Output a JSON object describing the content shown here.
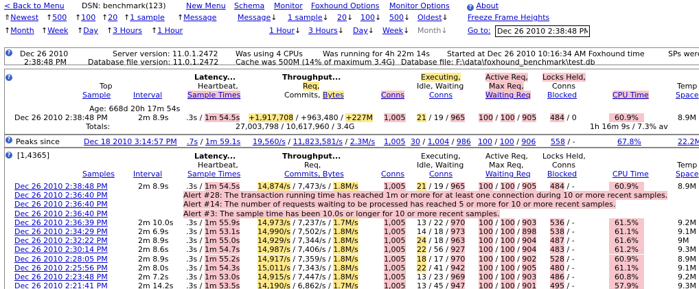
{
  "nav": {
    "back": "< Back to Menu",
    "dsn": "DSN: benchmark(123)",
    "new_menu": "New Menu",
    "schema": "Schema",
    "monitor": "Monitor",
    "foxhound_options": "Foxhound Options",
    "monitor_options": "Monitor Options",
    "about": "About",
    "newest": "Newest",
    "up500": "500",
    "up100": "100",
    "up20": "20",
    "up1sample": "1 sample",
    "message_up": "Message",
    "message_down": "Message",
    "down1sample": "1 sample",
    "down20": "20",
    "down100": "100",
    "down500": "500",
    "oldest": "Oldest",
    "freeze": "Freeze Frame Heights",
    "month_up": "Month",
    "week_up": "Week",
    "day_up": "Day",
    "hours3_up": "3 Hours",
    "hour1_up": "1 Hour",
    "hour1_down": "1 Hour",
    "hours3_down": "3 Hours",
    "day_down": "Day",
    "week_down": "Week",
    "month_down": "Month",
    "goto_label": "Go to:",
    "goto_value": "Dec 26 2010 2:38:48 PM"
  },
  "server": {
    "date": "Dec 26 2010",
    "time": "2:38:48 PM",
    "server_version": "Server version: 11.0.1.2472",
    "db_version": "Database file version: 11.0.1.2472",
    "cpus": "Was using 4 CPUs",
    "cache": "Cache was 500M (14% of maximum 3.4G)",
    "running": "Was running for 4h 22m 14s",
    "db_file": "Database file: F:\\data\\foxhound_benchmark\\test.db",
    "started": "Started at Dec 26 2010 10:16:34 AM Foxhound time",
    "sps": "SPs were"
  },
  "top": {
    "h_top": "Top",
    "h_sample": "Sample",
    "h_interval": "Interval",
    "h_latency": "Latency...",
    "h_heartbeat": "Heartbeat,",
    "h_sample_times": "Sample Times",
    "h_throughput": "Throughput...",
    "h_req": "Req,",
    "h_commits": "Commits,",
    "h_bytes": "Bytes",
    "h_conns": "Conns",
    "h_executing": "Executing,",
    "h_idle": "Idle, Waiting",
    "h_conns2": "Conns",
    "h_active": "Active Req,",
    "h_maxreq": "Max Req,",
    "h_waitingreq": "Waiting Req",
    "h_locks": "Locks Held,",
    "h_conns3": "Conns",
    "h_blocked": "Blocked",
    "h_cpu": "CPU Time",
    "h_temp": "Temp",
    "h_space": "Space",
    "age": "Age: 668d 20h 17m 54s",
    "r_sample": "Dec 26 2010 2:38:48 PM",
    "r_interval": "2m 8.9s",
    "r_hb": ".3s",
    "r_st": "1m 54.5s",
    "r_req": "+1,917,708",
    "r_commits": "+963,480",
    "r_bytes": "+227M",
    "r_conns": "1,005",
    "r_exec": "21",
    "r_idle": "19",
    "r_wait": "965",
    "r_active": "100",
    "r_max": "100",
    "r_waitreq": "905",
    "r_locks": "484",
    "r_blocked": "0",
    "r_cpu": "60.9%",
    "r_temp": "8.9M",
    "totals_label": "Totals:",
    "totals_tp": "27,003,798 / 10,617,960 / 3.4G",
    "totals_cpu": "1h 16m 9s / 7.3% av"
  },
  "peaks": {
    "label": "Peaks since",
    "since": "Dec 18 2010 3:14:57 PM",
    "hb": ".7s",
    "st": "1m 59.1s",
    "req": "19,560/s",
    "commits": "11,823,581/s",
    "bytes": "2.3M/s",
    "conns": "1,005",
    "exec": "30",
    "idle": "1,004",
    "wait": "986",
    "active": "100",
    "max": "100",
    "waitreq": "906",
    "locks": "558",
    "blocked": "-",
    "cpu": "67.8%",
    "temp": "22.2M"
  },
  "list": {
    "range": "[1,4365]",
    "h_samples": "Samples",
    "h_interval": "Interval",
    "h_latency": "Latency...",
    "h_heartbeat": "Heartbeat,",
    "h_sample_times": "Sample Times",
    "h_throughput": "Throughput...",
    "h_req": "Req,",
    "h_commits_bytes": "Commits, Bytes",
    "h_conns": "Conns",
    "h_executing": "Executing,",
    "h_idle": "Idle, Waiting",
    "h_conns2": "Conns",
    "h_active": "Active Req,",
    "h_maxreq": "Max Req,",
    "h_waitingreq": "Waiting Req",
    "h_locks": "Locks Held,",
    "h_conns3": "Conns",
    "h_blocked": "Blocked",
    "h_cpu": "CPU Time",
    "h_temp": "Temp",
    "h_space": "Space",
    "rows": [
      {
        "s": "Dec 26 2010 2:38:48 PM",
        "i": "2m 8.9s",
        "hb": ".3s",
        "st": "1m 54.5s",
        "req": "14,874/s",
        "com": "7,473/s",
        "by": "1.8M/s",
        "cn": "1,005",
        "ex": "21",
        "id": "19",
        "wt": "965",
        "ac": "100",
        "mx": "100",
        "wr": "905",
        "lk": "484",
        "bl": "-",
        "cpu": "60.9%",
        "tmp": "8.9M",
        "kind": "data"
      },
      {
        "s": "Dec 26 2010 2:36:40 PM",
        "alert": "Alert #28: The transaction running time has reached 1m or more for at least one connection during 10 or more recent samples.",
        "kind": "alert"
      },
      {
        "s": "Dec 26 2010 2:36:40 PM",
        "alert": "Alert #14: The number of requests waiting to be processed has reached 5 or more for 10 or more recent samples.",
        "kind": "alert"
      },
      {
        "s": "Dec 26 2010 2:36:40 PM",
        "alert": "Alert #3: The sample time has been 10.0s or longer for 10 or more recent samples.",
        "kind": "alert"
      },
      {
        "s": "Dec 26 2010 2:36:39 PM",
        "i": "2m 10.0s",
        "hb": ".3s",
        "st": "1m 55.9s",
        "req": "14,973/s",
        "com": "7,237/s",
        "by": "1.7M/s",
        "cn": "1,005",
        "ex": "13",
        "id": "22",
        "wt": "970",
        "ac": "100",
        "mx": "100",
        "wr": "903",
        "lk": "536",
        "bl": "-",
        "cpu": "61.5%",
        "tmp": "9.2M",
        "kind": "data"
      },
      {
        "s": "Dec 26 2010 2:34:29 PM",
        "i": "2m 6.9s",
        "hb": ".3s",
        "st": "1m 53.1s",
        "req": "14,990/s",
        "com": "7,502/s",
        "by": "1.8M/s",
        "cn": "1,005",
        "ex": "14",
        "id": "18",
        "wt": "973",
        "ac": "100",
        "mx": "100",
        "wr": "898",
        "lk": "538",
        "bl": "-",
        "cpu": "61.1%",
        "tmp": "9.1M",
        "kind": "data"
      },
      {
        "s": "Dec 26 2010 2:32:22 PM",
        "i": "2m 8.9s",
        "hb": ".3s",
        "st": "1m 55.0s",
        "req": "14,929/s",
        "com": "7,344/s",
        "by": "1.8M/s",
        "cn": "1,005",
        "ex": "24",
        "id": "18",
        "wt": "963",
        "ac": "100",
        "mx": "100",
        "wr": "904",
        "lk": "487",
        "bl": "-",
        "cpu": "61.6%",
        "tmp": "9M",
        "kind": "data"
      },
      {
        "s": "Dec 26 2010 2:30:14 PM",
        "i": "2m 8.6s",
        "hb": ".3s",
        "st": "1m 54.7s",
        "req": "14,987/s",
        "com": "7,406/s",
        "by": "1.8M/s",
        "cn": "1,005",
        "ex": "22",
        "id": "56",
        "wt": "927",
        "ac": "100",
        "mx": "100",
        "wr": "904",
        "lk": "483",
        "bl": "-",
        "cpu": "61.2%",
        "tmp": "9.3M",
        "kind": "data"
      },
      {
        "s": "Dec 26 2010 2:28:05 PM",
        "i": "2m 8.9s",
        "hb": ".3s",
        "st": "1m 55.2s",
        "req": "14,917/s",
        "com": "7,359/s",
        "by": "1.8M/s",
        "cn": "1,005",
        "ex": "18",
        "id": "17",
        "wt": "970",
        "ac": "100",
        "mx": "100",
        "wr": "902",
        "lk": "528",
        "bl": "-",
        "cpu": "60.9%",
        "tmp": "8.9M",
        "kind": "data"
      },
      {
        "s": "Dec 26 2010 2:25:56 PM",
        "i": "2m 8.0s",
        "hb": ".3s",
        "st": "1m 54.3s",
        "req": "15,011/s",
        "com": "7,343/s",
        "by": "1.8M/s",
        "cn": "1,005",
        "ex": "22",
        "id": "41",
        "wt": "942",
        "ac": "100",
        "mx": "100",
        "wr": "905",
        "lk": "480",
        "bl": "-",
        "cpu": "61.1%",
        "tmp": "9.1M",
        "kind": "data"
      },
      {
        "s": "Dec 26 2010 2:23:48 PM",
        "i": "2m 7.2s",
        "hb": ".3s",
        "st": "1m 53.0s",
        "req": "14,915/s",
        "com": "7,447/s",
        "by": "1.8M/s",
        "cn": "1,005",
        "ex": "13",
        "id": "23",
        "wt": "969",
        "ac": "100",
        "mx": "100",
        "wr": "903",
        "lk": "486",
        "bl": "-",
        "cpu": "60.8%",
        "tmp": "9.2M",
        "kind": "data"
      },
      {
        "s": "Dec 26 2010 2:21:41 PM",
        "i": "2m 14.2s",
        "hb": ".3s",
        "st": "1m 53.5s",
        "req": "14,190/s",
        "com": "6,862/s",
        "by": "1.7M/s",
        "cn": "1,005",
        "ex": "13",
        "id": "45",
        "wt": "947",
        "ac": "100",
        "mx": "100",
        "wr": "901",
        "lk": "495",
        "bl": "-",
        "cpu": "57.9%",
        "tmp": "9.3M",
        "kind": "data"
      }
    ]
  },
  "hl": {
    "yellow": "#ffe98a",
    "pink": "#f7c6cc",
    "link": "#0000cc"
  }
}
